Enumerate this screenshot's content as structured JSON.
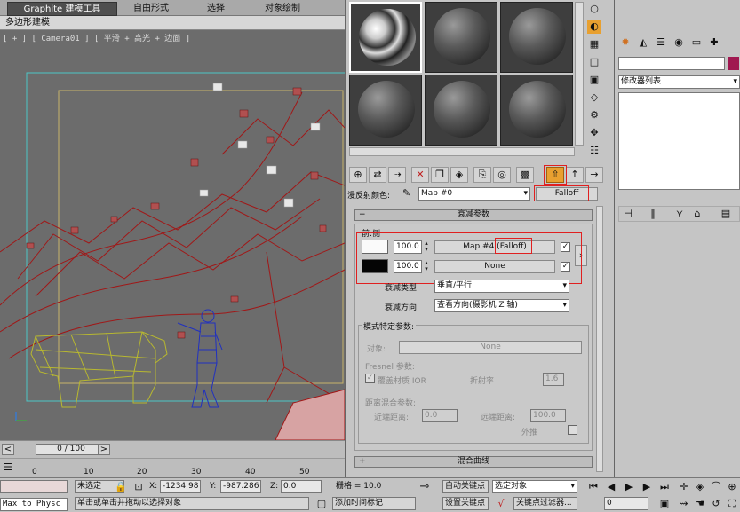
{
  "ribbon": {
    "tabs": [
      "Graphite 建模工具",
      "自由形式",
      "选择",
      "对象绘制"
    ],
    "subtab": "多边形建模"
  },
  "viewport": {
    "label": "[ + ] [ Camera01 ] [ 平滑 + 高光 + 边面 ]"
  },
  "timeline": {
    "frame": "0 / 100",
    "ticks": [
      "0",
      "10",
      "20",
      "30",
      "40",
      "50"
    ]
  },
  "material_editor": {
    "diffuse_label": "漫反射颜色:",
    "map_name": "Map #0",
    "map_type": "Falloff",
    "rollout_falloff": "衰减参数",
    "front_side_label": "前:侧",
    "row1": {
      "amount": "100.0",
      "map": "Map #4 (Falloff)"
    },
    "row2": {
      "amount": "100.0",
      "map": "None"
    },
    "falloff_type_label": "衰减类型:",
    "falloff_type_value": "垂直/平行",
    "falloff_dir_label": "衰减方向:",
    "falloff_dir_value": "查看方向(摄影机 Z 轴)",
    "mode_group": "模式特定参数:",
    "object_label": "对象:",
    "object_value": "None",
    "fresnel_label": "Fresnel 参数:",
    "override_ior_label": "覆盖材质 IOR",
    "ior_label": "折射率",
    "ior_value": "1.6",
    "distance_label": "距离混合参数:",
    "near_label": "近端距离:",
    "near_value": "0.0",
    "far_label": "远端距离:",
    "far_value": "100.0",
    "extrapolate_label": "外推",
    "rollout_mix": "混合曲线"
  },
  "modifier": {
    "list_label": "修改器列表"
  },
  "status": {
    "selection": "未选定",
    "x_label": "X:",
    "x_value": "-1234.98",
    "y_label": "Y:",
    "y_value": "-987.286",
    "z_label": "Z:",
    "z_value": "0.0",
    "grid": "栅格 = 10.0",
    "auto_key": "自动关键点",
    "selected_object": "选定对象",
    "set_key": "设置关键点",
    "key_filters": "关键点过滤器...",
    "prompt": "单击或单击并拖动以选择对象",
    "add_time_tag": "添加时间标记",
    "script_listener": "Max to Physc (",
    "frame_field": "0"
  },
  "colors": {
    "highlight": "#e02020",
    "active_tool": "#e8a030",
    "mesh_red": "#a01818",
    "mesh_yellow": "#b8b830",
    "mesh_blue": "#2030c0"
  }
}
